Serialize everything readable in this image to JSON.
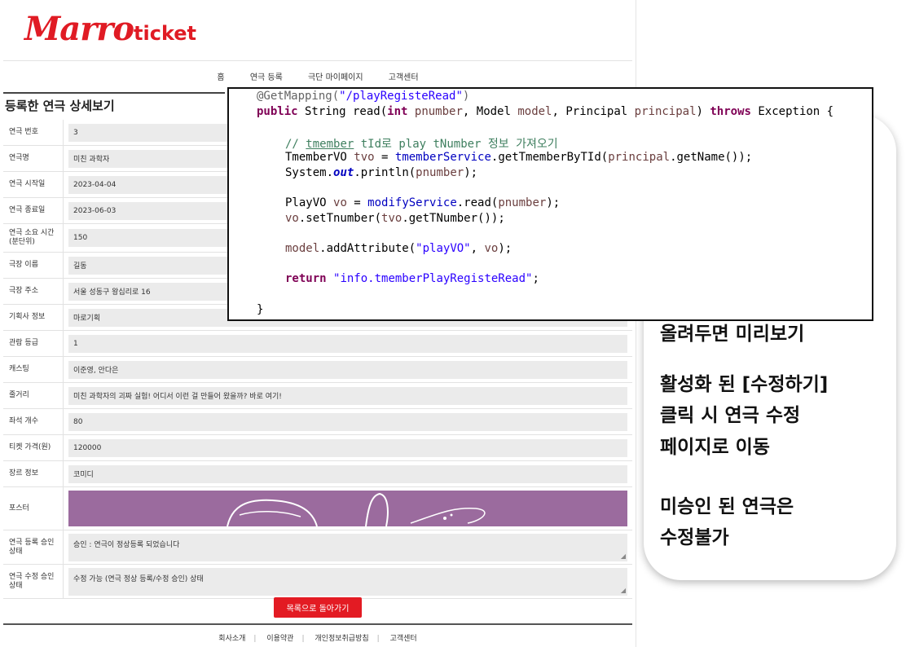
{
  "brand": {
    "script": "Marro",
    "suffix": "ticket"
  },
  "nav": [
    "홈",
    "연극 등록",
    "극단 마이페이지",
    "고객센터"
  ],
  "page_title": "등록한 연극 상세보기",
  "rows": [
    {
      "label": "연극 번호",
      "value": "3"
    },
    {
      "label": "연극명",
      "value": "미친 과학자"
    },
    {
      "label": "연극 시작일",
      "value": "2023-04-04"
    },
    {
      "label": "연극 종료일",
      "value": "2023-06-03"
    },
    {
      "label": "연극 소요 시간 (분단위)",
      "value": "150"
    },
    {
      "label": "극장 이름",
      "value": "길동"
    },
    {
      "label": "극장 주소",
      "value": "서울 성동구 왕십리로 16"
    },
    {
      "label": "기획사 정보",
      "value": "마로기획"
    },
    {
      "label": "관람 등급",
      "value": "1"
    },
    {
      "label": "캐스팅",
      "value": "이준영, 안다은"
    },
    {
      "label": "줄거리",
      "value": "미친 과학자의 괴짜 실험! 어디서 이런 걸 만들어 왔을까? 바로 여기!"
    },
    {
      "label": "좌석 개수",
      "value": "80"
    },
    {
      "label": "티켓 가격(원)",
      "value": "120000"
    },
    {
      "label": "장르 정보",
      "value": "코미디"
    }
  ],
  "poster_label": "포스터",
  "approval": [
    {
      "label": "연극 등록 승인 상태",
      "value": "승인 : 연극이 정상등록 되었습니다"
    },
    {
      "label": "연극 수정 승인 상태",
      "value": "수정 가능 (연극 정상 등록/수정 승인) 상태"
    }
  ],
  "back_button": "목록으로 돌아가기",
  "footer_links": [
    "회사소개",
    "이용약관",
    "개인정보취급방침",
    "고객센터"
  ],
  "code": {
    "annotation": "@GetMapping(",
    "mapping": "\"/playRegisteRead\"",
    "comment_a": "// ",
    "comment_u": "tmember",
    "comment_b": " tId로 play tNumber 정보 가져오기",
    "return_str": "\"info.tmemberPlayRegisteRead\""
  },
  "note": {
    "line1": "올려두면 미리보기",
    "line2": "활성화 된 [수정하기]",
    "line3": "클릭 시 연극 수정",
    "line4": "페이지로 이동",
    "line5": "미승인 된 연극은",
    "line6": "수정불가"
  }
}
